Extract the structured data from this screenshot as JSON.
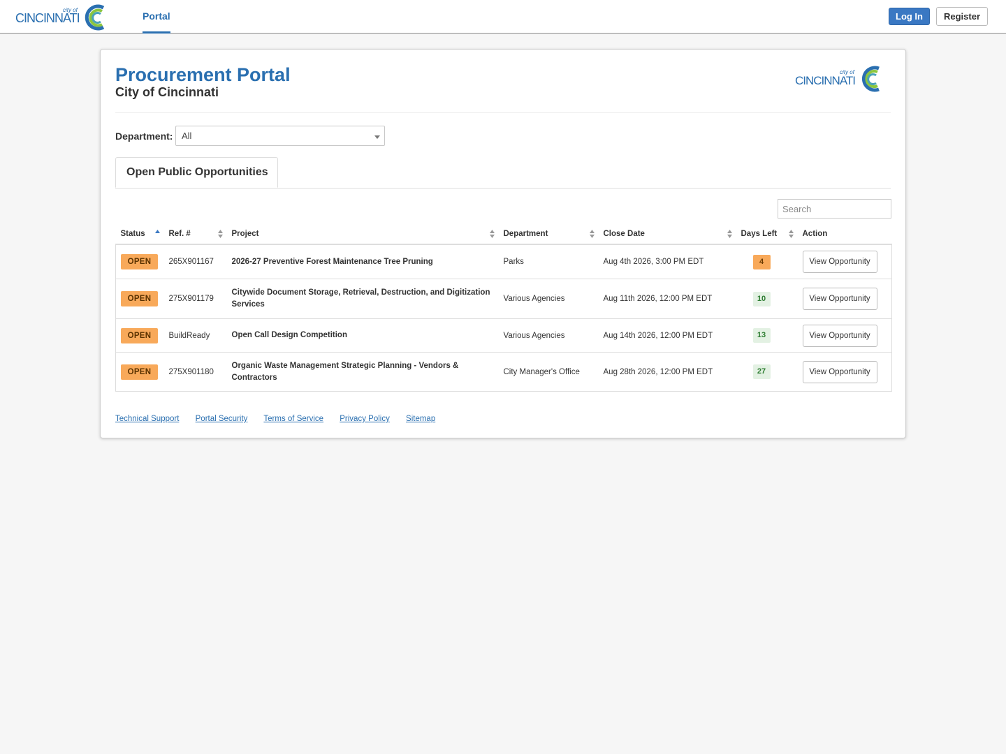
{
  "nav": {
    "portal_label": "Portal",
    "login_label": "Log In",
    "register_label": "Register"
  },
  "brand": {
    "logo_small": "city of CINCINNATI",
    "logo_text": "CINCINNATI",
    "logo_city_of": "city of",
    "colors": {
      "blue": "#2a6fb0",
      "green": "#8cc63f",
      "teal": "#4aa3b8"
    }
  },
  "header": {
    "title": "Procurement Portal",
    "subtitle": "City of Cincinnati"
  },
  "filter": {
    "department_label": "Department:",
    "department_value": "All"
  },
  "tabs": [
    {
      "label": "Open Public Opportunities",
      "active": true
    }
  ],
  "search": {
    "placeholder": "Search"
  },
  "table": {
    "columns": [
      "Status",
      "Ref. #",
      "Project",
      "Department",
      "Close Date",
      "Days Left",
      "Action"
    ],
    "rows": [
      {
        "status": "OPEN",
        "ref": "265X901167",
        "project": "2026-27 Preventive Forest Maintenance Tree Pruning",
        "department": "Parks",
        "close_date": "Aug 4th 2026, 3:00 PM EDT",
        "days_left": "4",
        "action": "View Opportunity"
      },
      {
        "status": "OPEN",
        "ref": "275X901179",
        "project": "Citywide Document Storage, Retrieval, Destruction, and Digitization Services",
        "department": "Various Agencies",
        "close_date": "Aug 11th 2026, 12:00 PM EDT",
        "days_left": "10",
        "action": "View Opportunity"
      },
      {
        "status": "OPEN",
        "ref": "BuildReady",
        "project": "Open Call Design Competition",
        "department": "Various Agencies",
        "close_date": "Aug 14th 2026, 12:00 PM EDT",
        "days_left": "13",
        "action": "View Opportunity"
      },
      {
        "status": "OPEN",
        "ref": "275X901180",
        "project": "Organic Waste Management Strategic Planning - Vendors & Contractors",
        "department": "City Manager's Office",
        "close_date": "Aug 28th 2026, 12:00 PM EDT",
        "days_left": "27",
        "action": "View Opportunity"
      }
    ]
  },
  "footer": {
    "links": [
      "Technical Support",
      "Portal Security",
      "Terms of Service",
      "Privacy Policy",
      "Sitemap"
    ]
  }
}
